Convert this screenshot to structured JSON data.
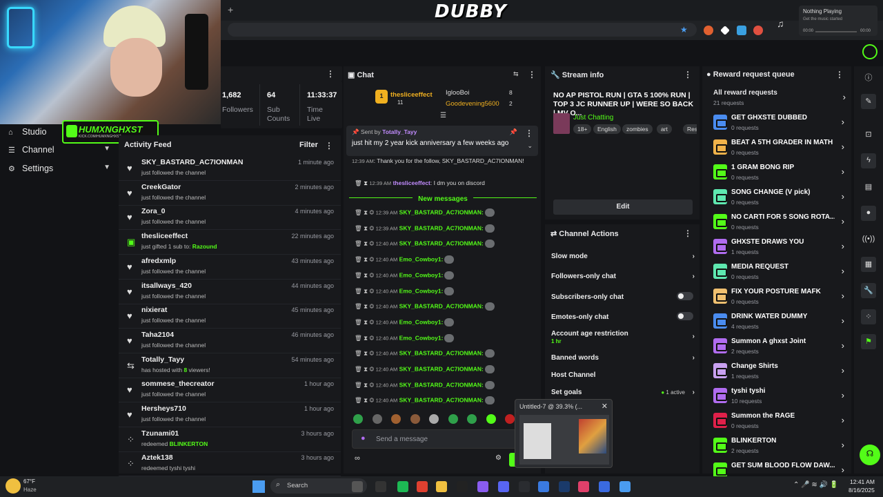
{
  "browser": {
    "logo": "DUBBY",
    "new_tab": "+"
  },
  "music": {
    "title": "Nothing Playing",
    "sub": "Get the music started",
    "t0": "00:00",
    "t1": "00:00"
  },
  "streamer_badge": {
    "name": "HUMXNGHXST",
    "url": "KICK.COM/HUMXNGHXST"
  },
  "nav": [
    {
      "label": "Studio",
      "icon": "home-icon"
    },
    {
      "label": "Channel",
      "icon": "list-icon"
    },
    {
      "label": "Settings",
      "icon": "gear-icon"
    }
  ],
  "stats": {
    "followers": "1,682",
    "followers_label": "Followers",
    "subs": "64",
    "subs_label": "Sub Counts",
    "time": "11:33:37",
    "time_label": "Time Live"
  },
  "feed": {
    "title": "Activity Feed",
    "filter": "Filter",
    "rows": [
      {
        "name": "SKY_BASTARD_AC7IONMAN",
        "sub": "just followed the channel",
        "time": "1 minute ago",
        "icon": "heart-icon"
      },
      {
        "name": "CreekGator",
        "sub": "just followed the channel",
        "time": "2 minutes ago",
        "icon": "heart-icon"
      },
      {
        "name": "Zora_0",
        "sub": "just followed the channel",
        "time": "4 minutes ago",
        "icon": "heart-icon"
      },
      {
        "name": "thesliceeffect",
        "sub": "just gifted 1 sub to: ",
        "hl": "Razound",
        "time": "22 minutes ago",
        "icon": "gift-icon"
      },
      {
        "name": "afredxmlp",
        "sub": "just followed the channel",
        "time": "43 minutes ago",
        "icon": "heart-icon"
      },
      {
        "name": "itsallways_420",
        "sub": "just followed the channel",
        "time": "44 minutes ago",
        "icon": "heart-icon"
      },
      {
        "name": "nixierat",
        "sub": "just followed the channel",
        "time": "45 minutes ago",
        "icon": "heart-icon"
      },
      {
        "name": "Taha2104",
        "sub": "just followed the channel",
        "time": "46 minutes ago",
        "icon": "heart-icon"
      },
      {
        "name": "Totally_Tayy",
        "sub": "has hosted with ",
        "hl": "8",
        "sub2": " viewers!",
        "time": "54 minutes ago",
        "icon": "host-icon"
      },
      {
        "name": "sommese_thecreator",
        "sub": "just followed the channel",
        "time": "1 hour ago",
        "icon": "heart-icon"
      },
      {
        "name": "Hersheys710",
        "sub": "just followed the channel",
        "time": "1 hour ago",
        "icon": "heart-icon"
      },
      {
        "name": "Tzunami01",
        "sub": "redeemed ",
        "hl": "BLINKERTON",
        "time": "3 hours ago",
        "icon": "reward-icon"
      },
      {
        "name": "Aztek138",
        "sub": "redeemed tyshi tyshi",
        "time": "3 hours ago",
        "icon": "reward-icon"
      }
    ]
  },
  "chat": {
    "title": "Chat",
    "lb1_name": "thesliceeffect",
    "lb1_count": "11",
    "lb1_rank": "1",
    "lb2_name": "IglooBoi",
    "lb2_count": "8",
    "lb3_name": "Goodevening5600",
    "lb3_count": "2",
    "pinned_by_label": "Sent by",
    "pinned_by": "Totally_Tayy",
    "pinned_text": "just hit my 2 year kick anniversary a few weeks ago",
    "m_follow": "12:39 AM",
    "m_follow_text": ": Thank you for the follow, SKY_BASTARD_AC7IONMAN!",
    "m_dm_time": "12:39 AM",
    "m_dm_user": "thesliceeffect",
    "m_dm_text": ": I dm you on discord",
    "new_messages": "New messages",
    "msgs": [
      {
        "t": "12:39 AM",
        "u": "SKY_BASTARD_AC7IONMAN:"
      },
      {
        "t": "12:39 AM",
        "u": "SKY_BASTARD_AC7IONMAN:"
      },
      {
        "t": "12:40 AM",
        "u": "SKY_BASTARD_AC7IONMAN:"
      },
      {
        "t": "12:40 AM",
        "u": "Emo_Cowboy1:"
      },
      {
        "t": "12:40 AM",
        "u": "Emo_Cowboy1:"
      },
      {
        "t": "12:40 AM",
        "u": "Emo_Cowboy1:"
      },
      {
        "t": "12:40 AM",
        "u": "SKY_BASTARD_AC7IONMAN:"
      },
      {
        "t": "12:40 AM",
        "u": "Emo_Cowboy1:"
      },
      {
        "t": "12:40 AM",
        "u": "Emo_Cowboy1:"
      },
      {
        "t": "12:40 AM",
        "u": "SKY_BASTARD_AC7IONMAN:"
      },
      {
        "t": "12:40 AM",
        "u": "SKY_BASTARD_AC7IONMAN:"
      },
      {
        "t": "12:40 AM",
        "u": "SKY_BASTARD_AC7IONMAN:"
      },
      {
        "t": "12:40 AM",
        "u": "SKY_BASTARD_AC7IONMAN:"
      }
    ],
    "input_placeholder": "Send a message"
  },
  "stream_info": {
    "title": "Stream info",
    "stream_title": "NO AP PISTOL RUN | GTA 5 100% RUN | TOP 3 JC RUNNER UP | WERE SO BACK | MV O...",
    "category": "Just Chatting",
    "tags": [
      "18+",
      "English",
      "zombies",
      "art",
      "Resid"
    ],
    "edit": "Edit"
  },
  "channel_actions": {
    "title": "Channel Actions",
    "items": [
      "Slow mode",
      "Followers-only chat",
      "Subscribers-only chat",
      "Emotes-only chat",
      "Account age restriction",
      "Banned words",
      "Host Channel",
      "Set goals"
    ],
    "age_value": "1 hr",
    "active": "1 active"
  },
  "popup": {
    "title": "Untitled-7 @ 39.3% (..."
  },
  "rewards": {
    "title": "Reward request queue",
    "all": "All reward requests",
    "all_count": "21 requests",
    "items": [
      {
        "name": "GET GHXSTE DUBBED",
        "count": "0 requests",
        "color": "#4a8cf0"
      },
      {
        "name": "BEAT A 5TH GRADER IN MATH",
        "count": "0 requests",
        "color": "#f0b24a"
      },
      {
        "name": "1 GRAM BONG RIP",
        "count": "0 requests",
        "color": "#53fc18"
      },
      {
        "name": "SONG CHANGE (V pick)",
        "count": "0 requests",
        "color": "#5ee8b0"
      },
      {
        "name": "NO CARTI FOR 5 SONG ROTA...",
        "count": "0 requests",
        "color": "#53fc18"
      },
      {
        "name": "GHXSTE DRAWS YOU",
        "count": "1 requests",
        "color": "#b06cf0"
      },
      {
        "name": "MEDIA REQUEST",
        "count": "0 requests",
        "color": "#5ee8b0"
      },
      {
        "name": "FIX YOUR POSTURE MAFK",
        "count": "0 requests",
        "color": "#f0c070"
      },
      {
        "name": "DRINK WATER DUMMY",
        "count": "4 requests",
        "color": "#4a8cf0"
      },
      {
        "name": "Summon A ghxst Joint",
        "count": "2 requests",
        "color": "#b06cf0"
      },
      {
        "name": "Change Shirts",
        "count": "1 requests",
        "color": "#c8a0f0"
      },
      {
        "name": "tyshi tyshi",
        "count": "10 requests",
        "color": "#b06cf0"
      },
      {
        "name": "Summon the RAGE",
        "count": "0 requests",
        "color": "#e0204a"
      },
      {
        "name": "BLINKERTON",
        "count": "2 requests",
        "color": "#53fc18"
      },
      {
        "name": "GET SUM BLOOD FLOW DAW...",
        "count": "",
        "color": "#53fc18"
      }
    ]
  },
  "taskbar": {
    "temp": "67°F",
    "weather": "Haze",
    "search": "Search",
    "time": "12:41 AM",
    "date": "8/16/2025"
  }
}
